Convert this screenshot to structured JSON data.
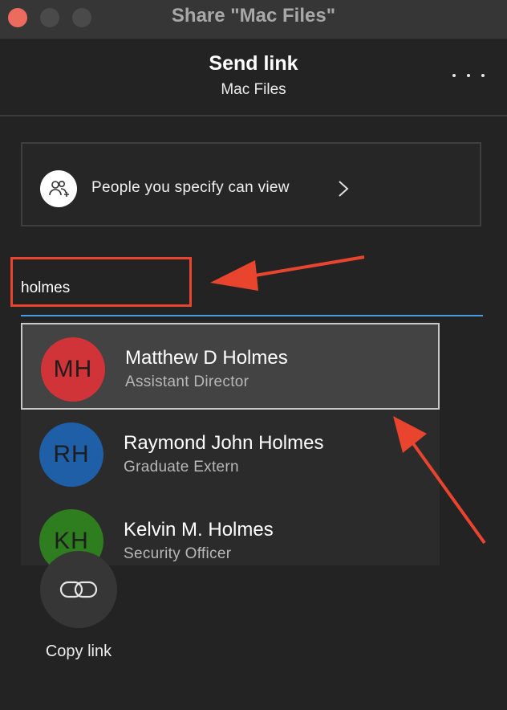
{
  "window": {
    "title": "Share \"Mac Files\""
  },
  "header": {
    "title": "Send link",
    "subtitle": "Mac Files"
  },
  "permission": {
    "label": "People you specify can view"
  },
  "search": {
    "value": "holmes"
  },
  "suggestions": [
    {
      "initials": "MH",
      "name": "Matthew D Holmes",
      "title": "Assistant Director",
      "color": "#d13438"
    },
    {
      "initials": "RH",
      "name": "Raymond John Holmes",
      "title": "Graduate Extern",
      "color": "#1f5fa8"
    },
    {
      "initials": "KH",
      "name": "Kelvin M. Holmes",
      "title": "Security Officer",
      "color": "#2e7d1f"
    }
  ],
  "copy_link": {
    "label": "Copy link"
  },
  "colors": {
    "annotation": "#e8442e",
    "accent": "#4a9ae0"
  }
}
